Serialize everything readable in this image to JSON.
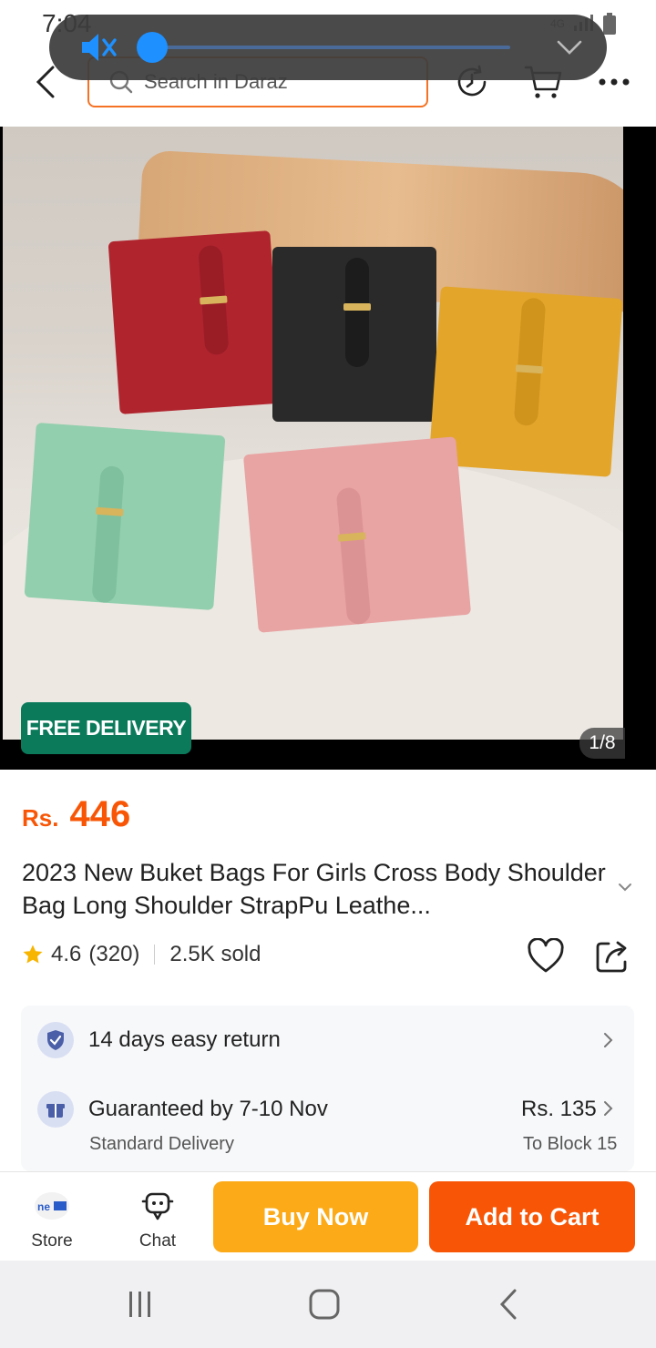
{
  "status_bar": {
    "time": "7:04",
    "network": "4G"
  },
  "volume": {
    "level": 0.02,
    "muted": true,
    "accent": "#1e90ff"
  },
  "header": {
    "search_placeholder": "Search in Daraz"
  },
  "gallery": {
    "badge": "FREE DELIVERY",
    "page_indicator": "1/8"
  },
  "product": {
    "currency": "Rs.",
    "price": "446",
    "title": "2023 New Buket Bags For Girls Cross Body Shoulder Bag  Long Shoulder  StrapPu Leathe...",
    "rating": "4.6",
    "reviews": "(320)",
    "sold": "2.5K sold"
  },
  "services": {
    "return": "14 days easy return",
    "delivery_title": "Guaranteed by 7-10 Nov",
    "delivery_type": "Standard Delivery",
    "delivery_fee": "Rs. 135",
    "delivery_to": "To Block 15"
  },
  "actions": {
    "store": "Store",
    "chat": "Chat",
    "buy_now": "Buy Now",
    "add_to_cart": "Add to Cart"
  },
  "colors": {
    "brand": "#f85606",
    "buy_now": "#fcaa17",
    "badge": "#0a7a5b"
  }
}
